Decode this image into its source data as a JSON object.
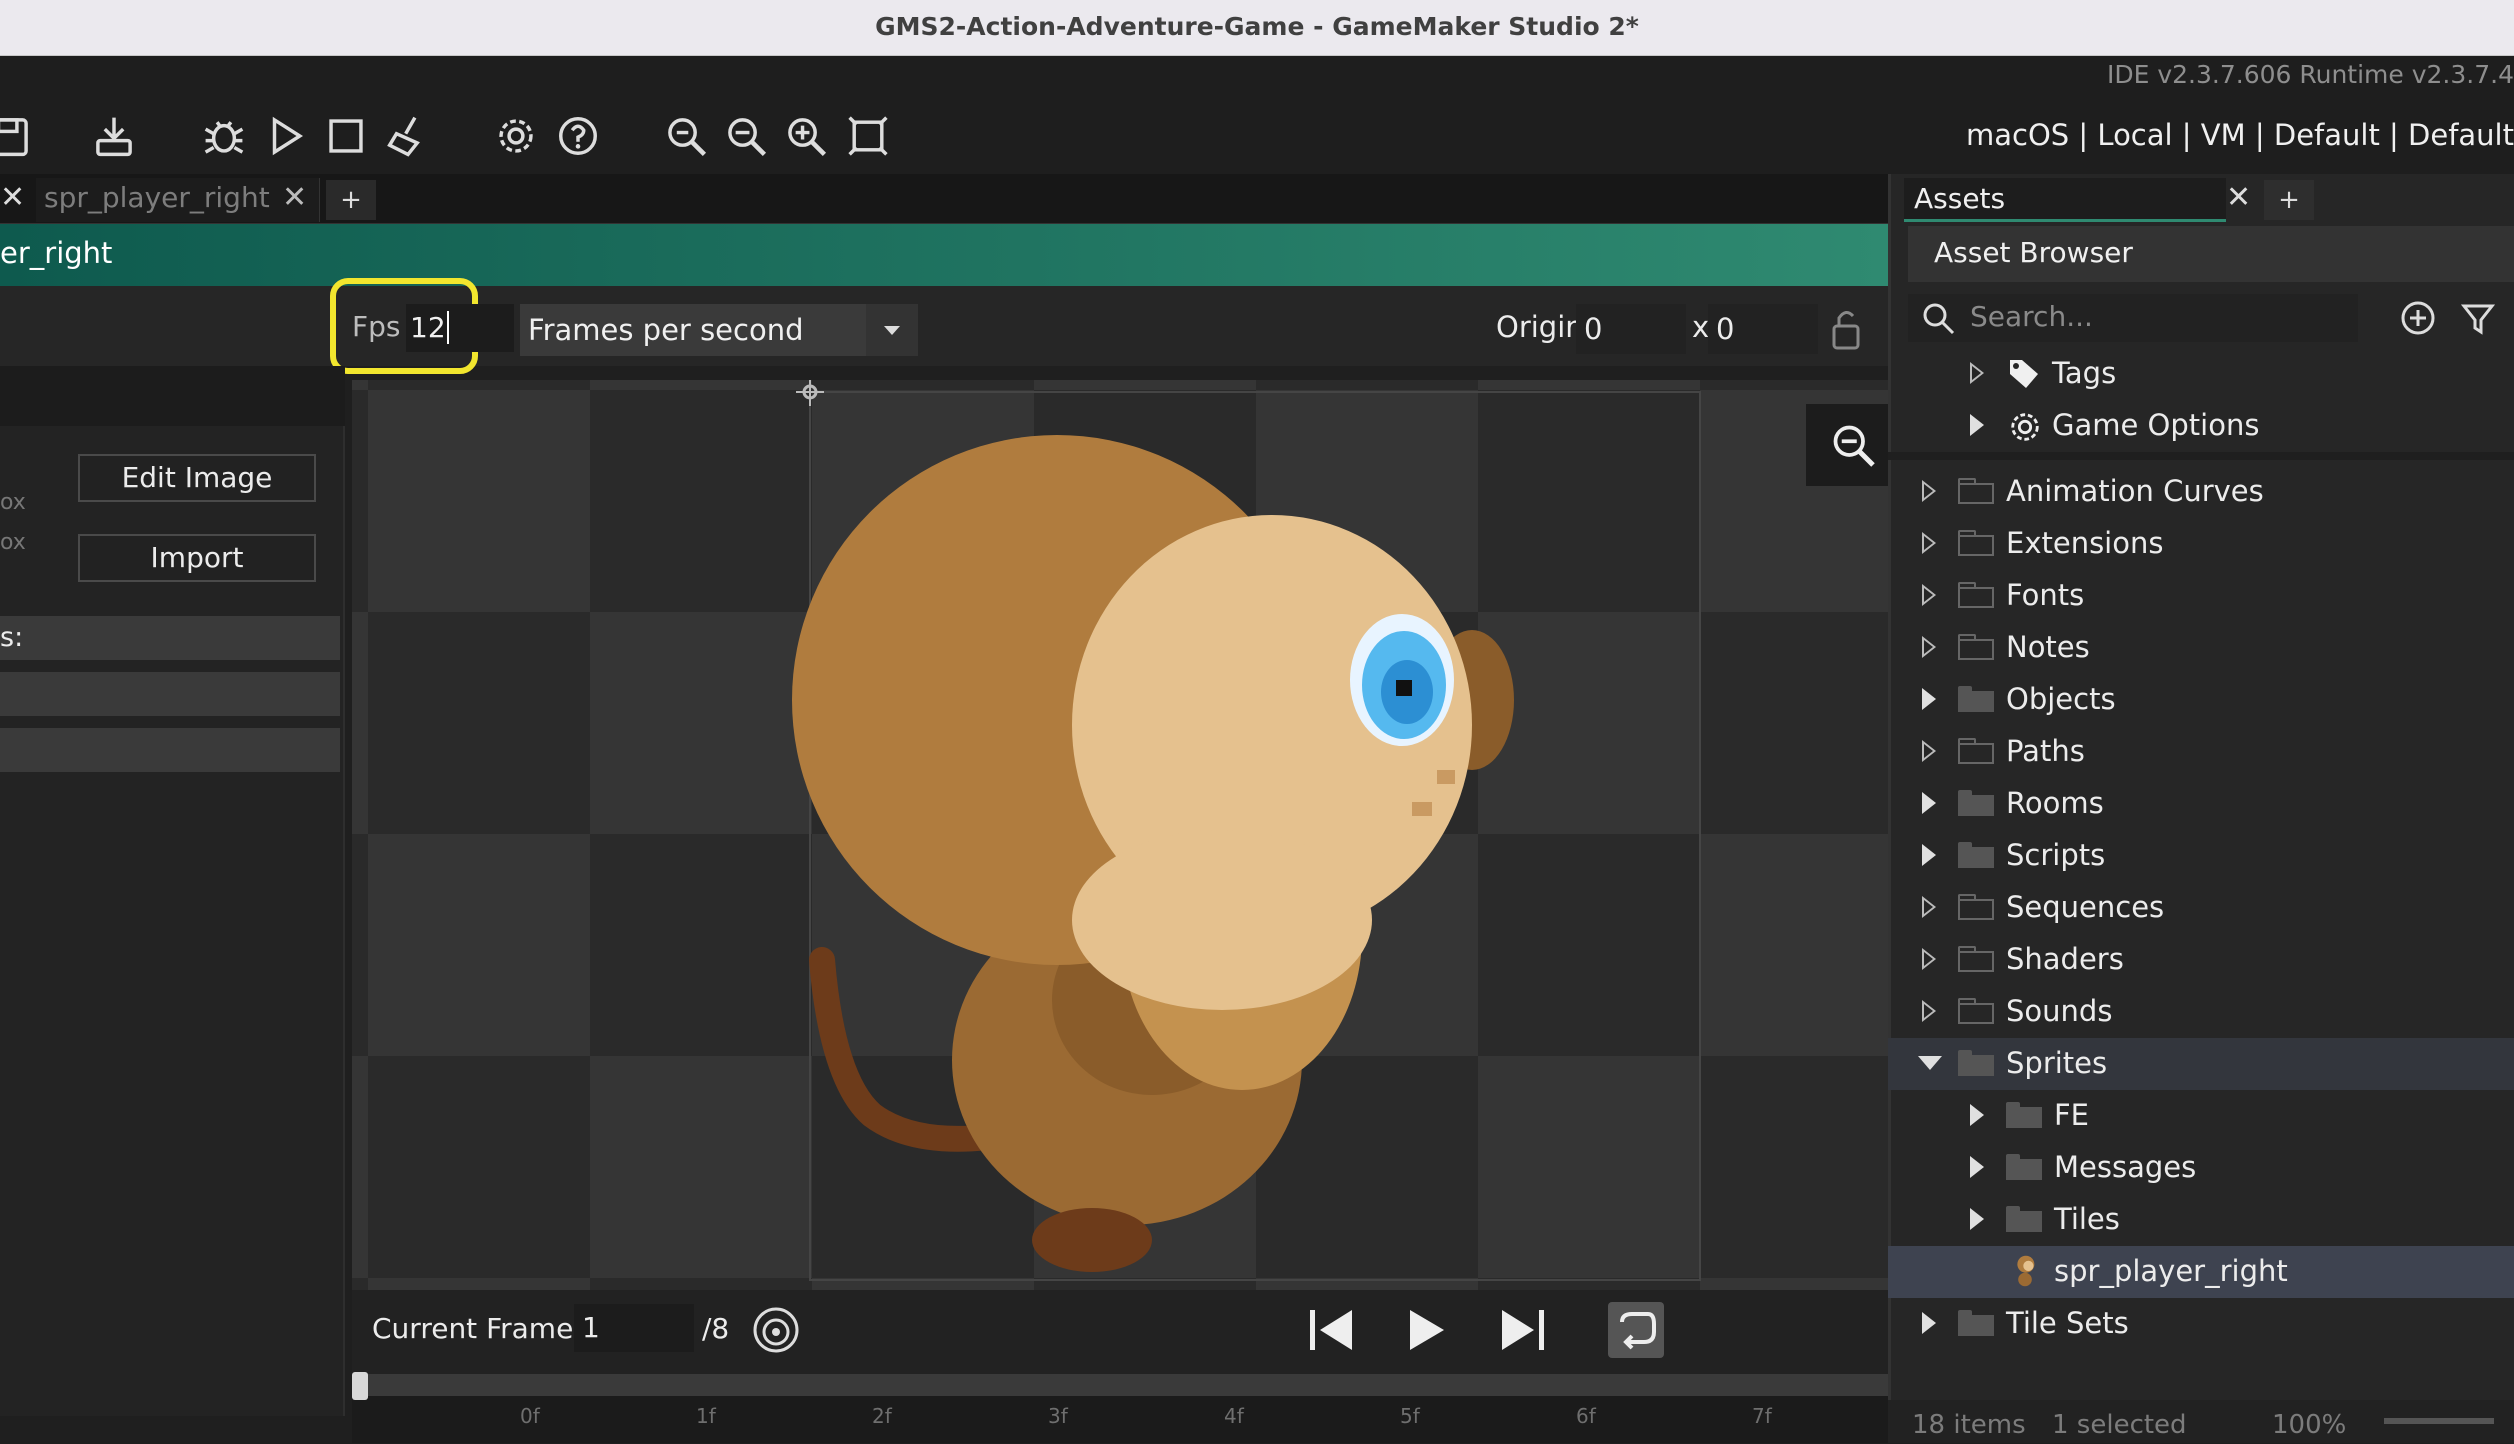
{
  "window": {
    "title": "GMS2-Action-Adventure-Game - GameMaker Studio 2*"
  },
  "header": {
    "version": "IDE v2.3.7.606  Runtime v2.3.7.4",
    "targets": "macOS | Local | VM | Default | Default"
  },
  "tabs": {
    "active": "spr_player_right",
    "add": "+"
  },
  "editor": {
    "name_partial": "er_right",
    "fps_label": "Fps",
    "fps_value": "12",
    "speed_mode": "Frames per second",
    "origin_label": "Origin",
    "origin_x": "0",
    "origin_sep": "x",
    "origin_y": "0",
    "left_frag_1": "ox",
    "left_frag_2": "ox",
    "left_frag_3": "s:",
    "edit_image": "Edit Image",
    "import": "Import"
  },
  "playback": {
    "current_frame_label": "Current Frame:",
    "current_frame_value": "1",
    "total_frames": "/8"
  },
  "timeline": {
    "ticks": [
      "0f",
      "1f",
      "2f",
      "3f",
      "4f",
      "5f",
      "6f",
      "7f"
    ]
  },
  "assets": {
    "tab_label": "Assets",
    "add": "+",
    "browser_title": "Asset Browser",
    "search_placeholder": "Search...",
    "items": [
      {
        "label": "Tags"
      },
      {
        "label": "Game Options"
      },
      {
        "label": "Animation Curves"
      },
      {
        "label": "Extensions"
      },
      {
        "label": "Fonts"
      },
      {
        "label": "Notes"
      },
      {
        "label": "Objects"
      },
      {
        "label": "Paths"
      },
      {
        "label": "Rooms"
      },
      {
        "label": "Scripts"
      },
      {
        "label": "Sequences"
      },
      {
        "label": "Shaders"
      },
      {
        "label": "Sounds"
      },
      {
        "label": "Sprites"
      },
      {
        "label": "FE"
      },
      {
        "label": "Messages"
      },
      {
        "label": "Tiles"
      },
      {
        "label": "spr_player_right"
      },
      {
        "label": "Tile Sets"
      }
    ],
    "footer": {
      "count": "18 items",
      "selected": "1 selected",
      "zoom": "100%"
    }
  },
  "colors": {
    "accent_green": "#2f8a71",
    "highlight_yellow": "#f2e62e",
    "selection": "#3e4350"
  }
}
